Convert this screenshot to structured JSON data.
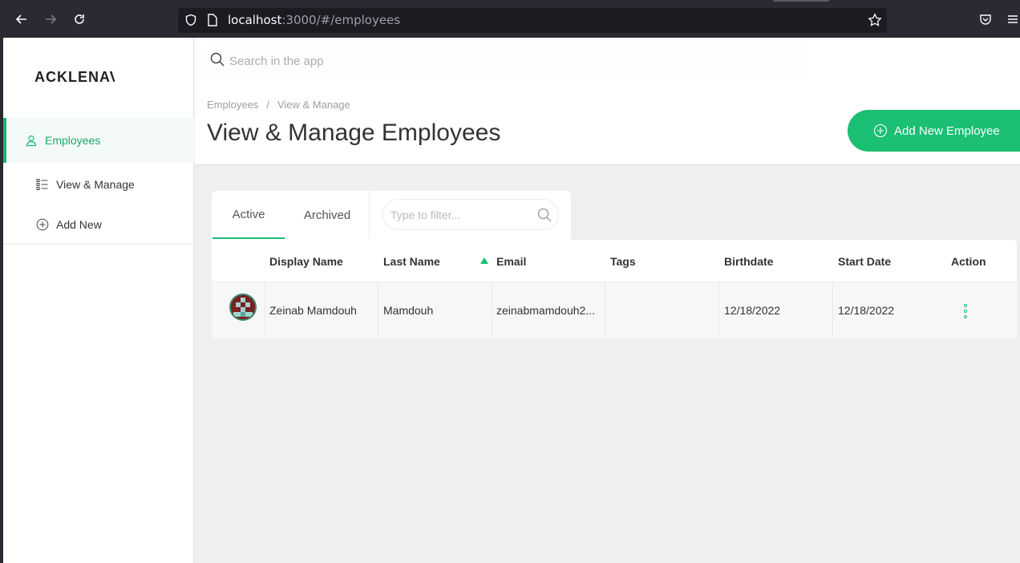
{
  "browser": {
    "url_host": "localhost",
    "url_path": ":3000/#/employees"
  },
  "sidebar": {
    "logo": "ACKLENAV",
    "items": [
      {
        "label": "Employees",
        "icon": "user-icon",
        "active": true
      },
      {
        "label": "View & Manage",
        "icon": "list-icon",
        "active": false
      },
      {
        "label": "Add New",
        "icon": "plus-circle-icon",
        "active": false
      }
    ]
  },
  "header": {
    "search_placeholder": "Search in the app",
    "breadcrumb": [
      "Employees",
      "/",
      "View & Manage"
    ],
    "title": "View & Manage Employees",
    "add_button_label": "Add New Employee"
  },
  "tabs": {
    "items": [
      "Active",
      "Archived"
    ],
    "active": "Active",
    "filter_placeholder": "Type to filter..."
  },
  "table": {
    "columns": [
      "Display Name",
      "Last Name",
      "Email",
      "Tags",
      "Birthdate",
      "Start Date",
      "Action"
    ],
    "sorted_by": "Last Name",
    "rows": [
      {
        "display_name": "Zeinab Mamdouh",
        "last_name": "Mamdouh",
        "email": "zeinabmamdouh2...",
        "tags": "",
        "birthdate": "12/18/2022",
        "start_date": "12/18/2022"
      }
    ]
  },
  "colors": {
    "accent": "#1abf74",
    "browser_bg": "#2b2a33"
  }
}
